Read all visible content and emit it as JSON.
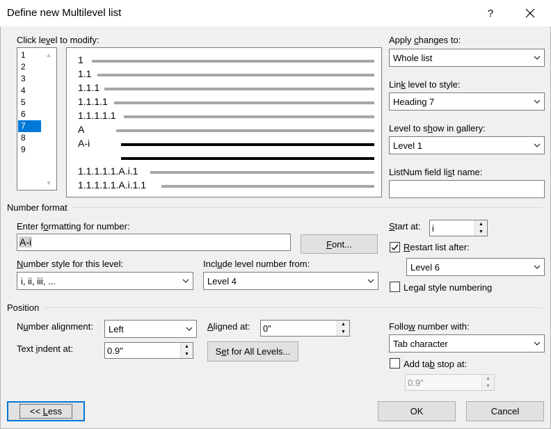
{
  "window": {
    "title": "Define new Multilevel list",
    "help_label": "?"
  },
  "click_level": {
    "label_pre": "Click le",
    "label_key": "v",
    "label_post": "el to modify:",
    "items": [
      "1",
      "2",
      "3",
      "4",
      "5",
      "6",
      "7",
      "8",
      "9"
    ],
    "selected": "7"
  },
  "preview": {
    "rows": [
      "1",
      "1.1",
      "1.1.1",
      "1.1.1.1",
      "1.1.1.1.1",
      "A",
      "A-i",
      "",
      "1.1.1.1.1.A.i.1",
      "1.1.1.1.1.A.i.1.1"
    ]
  },
  "apply_changes": {
    "label_pre": "Apply ",
    "label_key": "c",
    "label_post": "hanges to:",
    "value": "Whole list"
  },
  "link_level": {
    "label_pre": "Lin",
    "label_key": "k",
    "label_post": " level to style:",
    "value": "Heading 7"
  },
  "gallery_level": {
    "label_pre": "Level to s",
    "label_key": "h",
    "label_post": "ow in gallery:",
    "value": "Level 1"
  },
  "listnum": {
    "label_pre": "ListNum field li",
    "label_key": "s",
    "label_post": "t name:",
    "value": ""
  },
  "number_format": {
    "section_label": "Number format",
    "enter_label_pre": "Enter f",
    "enter_label_key": "o",
    "enter_label_post": "rmatting for number:",
    "format_value": "A-i",
    "font_button_pre": "",
    "font_button_key": "F",
    "font_button_post": "ont...",
    "style_label_pre": "",
    "style_label_key": "N",
    "style_label_post": "umber style for this level:",
    "style_value": "i, ii, iii, ...",
    "include_label_pre": "Incl",
    "include_label_key": "u",
    "include_label_post": "de level number from:",
    "include_value": "Level 4",
    "start_label_pre": "",
    "start_label_key": "S",
    "start_label_post": "tart at:",
    "start_value": "i",
    "restart_label_pre": "",
    "restart_label_key": "R",
    "restart_label_post": "estart list after:",
    "restart_checked": true,
    "restart_value": "Level 6",
    "legal_label_pre": "Le",
    "legal_label_key": "g",
    "legal_label_post": "al style numbering",
    "legal_checked": false
  },
  "position": {
    "section_label": "Position",
    "alignment_label_pre": "N",
    "alignment_label_key": "u",
    "alignment_label_post": "mber alignment:",
    "alignment_value": "Left",
    "aligned_at_label_pre": "",
    "aligned_at_label_key": "A",
    "aligned_at_label_post": "ligned at:",
    "aligned_at_value": "0\"",
    "indent_label_pre": "Text ",
    "indent_label_key": "i",
    "indent_label_post": "ndent at:",
    "indent_value": "0.9\"",
    "set_all_pre": "S",
    "set_all_key": "e",
    "set_all_post": "t for All Levels...",
    "follow_label_pre": "Follo",
    "follow_label_key": "w",
    "follow_label_post": " number with:",
    "follow_value": "Tab character",
    "tabstop_label_pre": "Add ta",
    "tabstop_label_key": "b",
    "tabstop_label_post": " stop at:",
    "tabstop_checked": false,
    "tabstop_value": "0.9\""
  },
  "footer": {
    "less_pre": "<< ",
    "less_key": "L",
    "less_post": "ess",
    "ok_label": "OK",
    "cancel_label": "Cancel"
  }
}
